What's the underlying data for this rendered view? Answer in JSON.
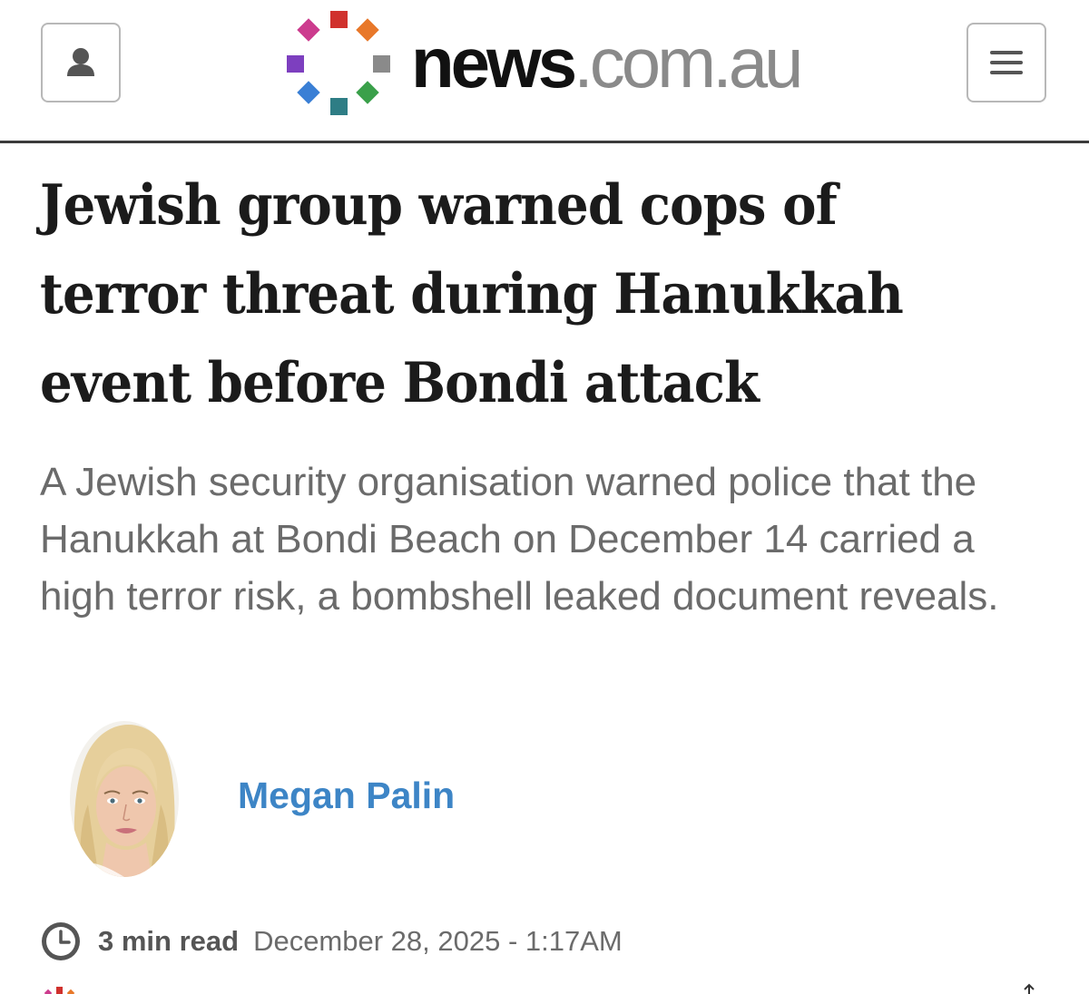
{
  "header": {
    "logo_news": "news",
    "logo_domain": ".com.au",
    "logo_dot_colors": [
      "#d0312d",
      "#e8782a",
      "#8a8a8a",
      "#3aa04a",
      "#2e7d85",
      "#3a7fd5",
      "#7d3fbf",
      "#cc3c8e"
    ],
    "account_icon": "user-icon",
    "menu_icon": "hamburger-menu-icon",
    "rule_color": "#3b3b3b"
  },
  "article": {
    "headline": "Jewish group warned cops of terror threat during Hanukkah event before Bondi attack",
    "standfirst": "A Jewish security organisation warned police that the Hanukkah at Bondi Beach on December 14 carried a high terror risk, a bombshell leaked document reveals.",
    "author": {
      "name": "Megan Palin",
      "name_color": "#3d85c6"
    },
    "meta": {
      "clock_icon": "clock-icon",
      "read_time": "3 min read",
      "published": "December 28, 2025 - 1:17AM"
    }
  }
}
